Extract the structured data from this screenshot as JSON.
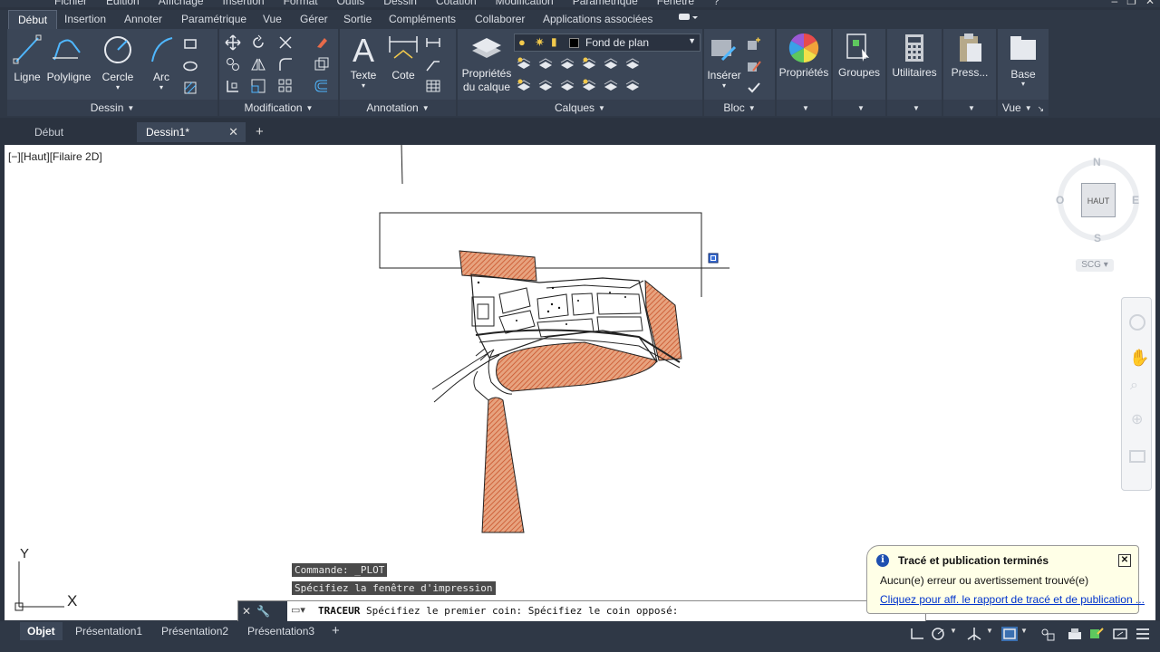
{
  "menubar": {
    "items": [
      "Fichier",
      "Edition",
      "Affichage",
      "Insertion",
      "Format",
      "Outils",
      "Dessin",
      "Cotation",
      "Modification",
      "Paramétrique",
      "Fenêtre",
      "?"
    ]
  },
  "ribbon_tabs": {
    "items": [
      "Début",
      "Insertion",
      "Annoter",
      "Paramétrique",
      "Vue",
      "Gérer",
      "Sortie",
      "Compléments",
      "Collaborer",
      "Applications associées"
    ]
  },
  "ribbon": {
    "dessin": {
      "title": "Dessin",
      "ligne": "Ligne",
      "polyligne": "Polyligne",
      "cercle": "Cercle",
      "arc": "Arc"
    },
    "modification": {
      "title": "Modification"
    },
    "annotation": {
      "title": "Annotation",
      "texte": "Texte",
      "cote": "Cote"
    },
    "calques": {
      "title": "Calques",
      "props": "Propriétés",
      "props2": "du calque",
      "layer_name": "Fond de plan"
    },
    "bloc": {
      "title": "Bloc",
      "inserer": "Insérer"
    },
    "proprietes": {
      "label": "Propriétés"
    },
    "groupes": {
      "label": "Groupes"
    },
    "utilitaires": {
      "label": "Utilitaires"
    },
    "presse": {
      "label": "Press..."
    },
    "vue": {
      "base": "Base",
      "title": "Vue"
    }
  },
  "file_tabs": {
    "debut": "Début",
    "dessin": "Dessin1*"
  },
  "canvas": {
    "view_label": "[−][Haut][Filaire 2D]",
    "viewcube": {
      "n": "N",
      "s": "S",
      "e": "E",
      "o": "O",
      "face": "HAUT",
      "ucs": "SCG"
    },
    "ucs_x": "X",
    "ucs_y": "Y"
  },
  "command": {
    "history1": "Commande: _PLOT",
    "history2": "Spécifiez la fenêtre d'impression",
    "prompt_cmd": "TRACEUR",
    "prompt_text": " Spécifiez le premier coin: Spécifiez le coin opposé:"
  },
  "notification": {
    "title": "Tracé et publication terminés",
    "message": "Aucun(e) erreur ou avertissement trouvé(e)",
    "link": "Cliquez pour aff. le rapport de tracé et de publication ..."
  },
  "layout_tabs": {
    "objet": "Objet",
    "p1": "Présentation1",
    "p2": "Présentation2",
    "p3": "Présentation3"
  },
  "colors": {
    "accent": "#3c4758",
    "hatch": "#d9764a",
    "background": "#2b3340"
  }
}
